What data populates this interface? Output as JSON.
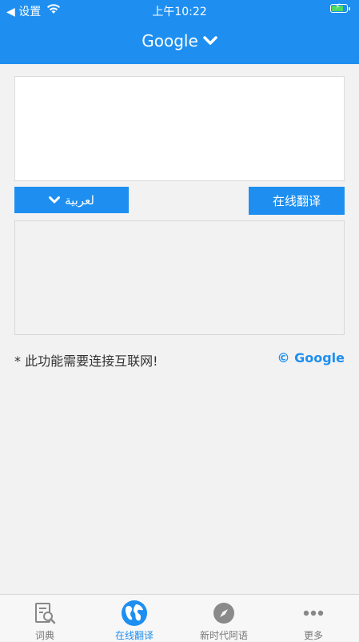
{
  "status_bar": {
    "back_label": "◀ 设置",
    "time": "上午10:22"
  },
  "header": {
    "title": "Google"
  },
  "input": {
    "value": ""
  },
  "language_button": {
    "label": "لعربية"
  },
  "translate_button": {
    "label": "在线翻译"
  },
  "output": {
    "value": ""
  },
  "footer": {
    "note": "* 此功能需要连接互联网!",
    "credit": "© Google"
  },
  "tabs": [
    {
      "label": "词典",
      "icon": "dictionary-search-icon",
      "active": false
    },
    {
      "label": "在线翻译",
      "icon": "globe-icon",
      "active": true
    },
    {
      "label": "新时代阿语",
      "icon": "compass-icon",
      "active": false
    },
    {
      "label": "更多",
      "icon": "more-dots-icon",
      "active": false
    }
  ],
  "colors": {
    "primary": "#1e8ff0",
    "background": "#f2f2f2",
    "tab_inactive": "#777777",
    "battery": "#4cd964"
  }
}
